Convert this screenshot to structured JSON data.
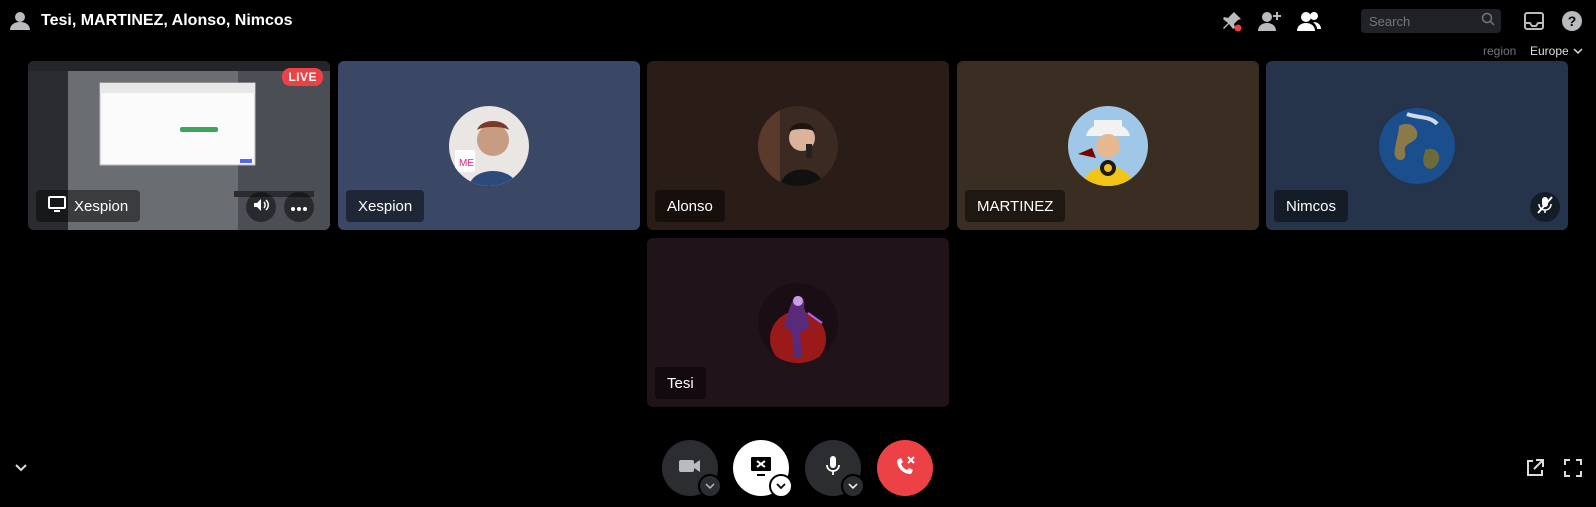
{
  "header": {
    "title": "Tesi, MARTINEZ, Alonso, Nimcos",
    "icons": [
      "people-icon",
      "pin-icon",
      "add-friend-icon",
      "member-list-icon",
      "inbox-icon",
      "help-icon"
    ],
    "search": {
      "placeholder": "Search"
    },
    "region_label": "region",
    "region_value": "Europe"
  },
  "tiles": [
    {
      "name": "Xespion",
      "type": "stream",
      "live_label": "LIVE",
      "bg": "#2b2d31"
    },
    {
      "name": "Xespion",
      "type": "user",
      "bg": "#3a4865",
      "avatar": "face-avatar"
    },
    {
      "name": "Alonso",
      "type": "user",
      "bg": "#2a1c17",
      "avatar": "mirror-avatar"
    },
    {
      "name": "MARTINEZ",
      "type": "user",
      "bg": "#3a2d22",
      "avatar": "anime-avatar"
    },
    {
      "name": "Nimcos",
      "type": "user",
      "bg": "#25344a",
      "avatar": "earth-avatar",
      "muted": true
    },
    {
      "name": "Tesi",
      "type": "user",
      "bg": "#21131a",
      "avatar": "hero-avatar"
    }
  ],
  "controls": {
    "camera": {
      "state": "off",
      "bg": "#2b2d31"
    },
    "screen_share": {
      "state": "active",
      "bg": "#ffffff"
    },
    "microphone": {
      "state": "on",
      "bg": "#2b2d31"
    },
    "disconnect": {
      "bg": "#ed4245"
    }
  },
  "colors": {
    "live": "#ed4245",
    "mute_indicator": "#ed4245"
  }
}
